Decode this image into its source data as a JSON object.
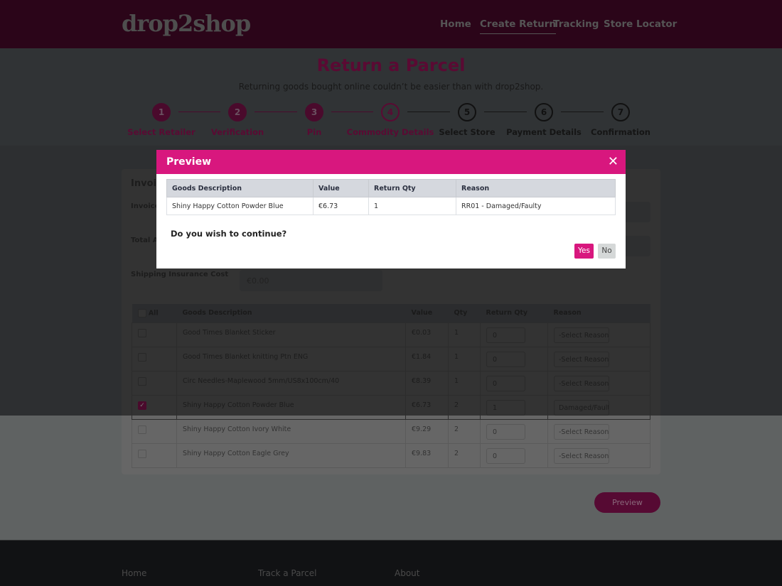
{
  "header": {
    "logo": "drop2shop",
    "nav": [
      "Home",
      "Create Return",
      "Tracking",
      "Store Locator"
    ],
    "active_nav": "Create Return"
  },
  "page": {
    "title": "Return a Parcel",
    "subtitle": "Returning goods bought online couldn’t be easier than with drop2shop."
  },
  "steps": [
    {
      "n": "1",
      "label": "Select Retailer",
      "state": "done"
    },
    {
      "n": "2",
      "label": "Verification",
      "state": "done"
    },
    {
      "n": "3",
      "label": "Pin",
      "state": "done"
    },
    {
      "n": "4",
      "label": "Commodity Details",
      "state": "current"
    },
    {
      "n": "5",
      "label": "Select Store",
      "state": "todo"
    },
    {
      "n": "6",
      "label": "Payment Details",
      "state": "todo"
    },
    {
      "n": "7",
      "label": "Confirmation",
      "state": "todo"
    }
  ],
  "form": {
    "heading": "Invoice Details",
    "invoice_label": "Invoice Number",
    "total_label": "Total Amount",
    "shipping_label": "Shipping Insurance Cost",
    "shipping_value": "€0.00"
  },
  "table": {
    "headers": [
      "All",
      "Goods Description",
      "Value",
      "Qty",
      "Return Qty",
      "Reason"
    ],
    "rows": [
      {
        "checked": false,
        "desc": "Good Times Blanket Sticker",
        "value": "€0.03",
        "qty": "1",
        "return_qty": "0",
        "reason": "-Select Reason-"
      },
      {
        "checked": false,
        "desc": "Good Times Blanket knitting Ptn ENG",
        "value": "€1.84",
        "qty": "1",
        "return_qty": "0",
        "reason": "-Select Reason-"
      },
      {
        "checked": false,
        "desc": "Circ Needles-Maplewood 5mm/US8x100cm/40",
        "value": "€8.39",
        "qty": "1",
        "return_qty": "0",
        "reason": "-Select Reason-"
      },
      {
        "checked": true,
        "desc": "Shiny Happy Cotton Powder Blue",
        "value": "€6.73",
        "qty": "2",
        "return_qty": "1",
        "reason": "Damaged/Faulty"
      },
      {
        "checked": false,
        "desc": "Shiny Happy Cotton Ivory White",
        "value": "€9.29",
        "qty": "2",
        "return_qty": "0",
        "reason": "-Select Reason-"
      },
      {
        "checked": false,
        "desc": "Shiny Happy Cotton Eagle Grey",
        "value": "€9.83",
        "qty": "2",
        "return_qty": "0",
        "reason": "-Select Reason-"
      }
    ]
  },
  "preview_button": "Preview",
  "footer": {
    "links": [
      "Home",
      "Track a Parcel",
      "About"
    ]
  },
  "modal": {
    "title": "Preview",
    "close_icon": "close-icon",
    "headers": [
      "Goods Description",
      "Value",
      "Return Qty",
      "Reason"
    ],
    "row": [
      "Shiny Happy Cotton Powder Blue",
      "€6.73",
      "1",
      "RR01 - Damaged/Faulty"
    ],
    "question": "Do you wish to continue?",
    "yes": "Yes",
    "no": "No"
  },
  "colors": {
    "brand": "#d8177e",
    "footer": "#2c2e31"
  }
}
